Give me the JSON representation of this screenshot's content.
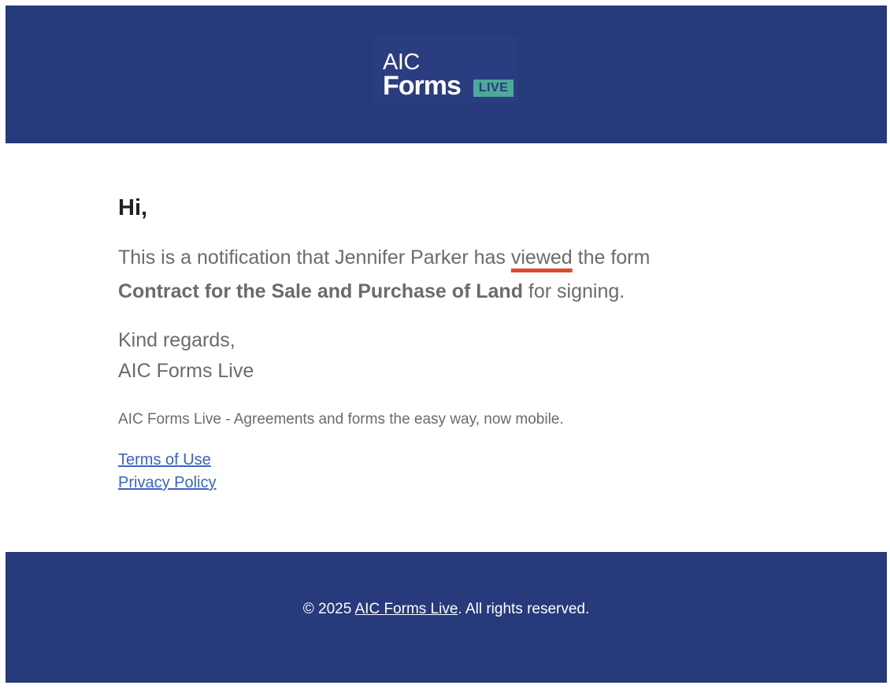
{
  "colors": {
    "brand_navy": "#263a7c",
    "logo_badge": "#4fa89b",
    "body_text": "#6b6b6b",
    "heading_text": "#222222",
    "link": "#3a63c8",
    "underline_highlight": "#e04a2f"
  },
  "logo": {
    "line1": "AIC",
    "line2": "Forms",
    "badge": "LIVE"
  },
  "email": {
    "greeting": "Hi,",
    "notification_prefix": "This is a notification that Jennifer Parker has ",
    "action_word": "viewed",
    "notification_suffix": " the form",
    "form_name": "Contract for the Sale and Purchase of Land",
    "form_suffix": " for signing.",
    "signoff": "Kind regards,",
    "sender": "AIC Forms Live",
    "tagline": "AIC Forms Live - Agreements and forms the easy way, now mobile.",
    "links": {
      "terms": "Terms of Use",
      "privacy": "Privacy Policy"
    }
  },
  "footer": {
    "copyright_prefix": "© 2025 ",
    "company_link": "AIC Forms Live",
    "copyright_suffix": ". All rights reserved."
  }
}
